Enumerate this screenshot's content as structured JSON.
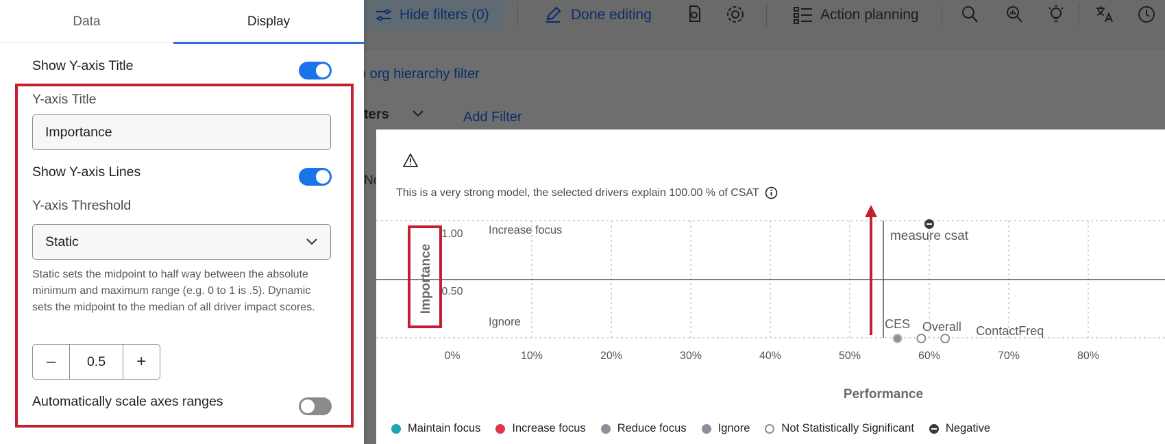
{
  "panel": {
    "tabs": {
      "data": "Data",
      "display": "Display"
    },
    "show_y_title": {
      "label": "Show Y-axis Title",
      "on": true
    },
    "y_title": {
      "label": "Y-axis Title",
      "value": "Importance"
    },
    "show_y_lines": {
      "label": "Show Y-axis Lines",
      "on": true
    },
    "threshold": {
      "label": "Y-axis Threshold",
      "selected": "Static",
      "help": "Static sets the midpoint to half way between the absolute minimum and maximum range (e.g. 0 to 1 is .5). Dynamic sets the midpoint to the median of all driver impact scores."
    },
    "stepper": {
      "minus": "–",
      "value": "0.5",
      "plus": "+"
    },
    "auto_scale": {
      "label": "Automatically scale axes ranges",
      "on": false
    }
  },
  "toolbar": {
    "hide_filters": "Hide filters (0)",
    "done_editing": "Done editing",
    "action_planning": "Action planning"
  },
  "background": {
    "org_filter": "n org hierarchy filter",
    "filters_partial": "ters",
    "add_filter": "Add Filter",
    "no_partial": "No"
  },
  "card": {
    "model_text": "This is a very strong model, the selected drivers explain 100.00 % of CSAT"
  },
  "chart_data": {
    "type": "scatter",
    "title": "",
    "xlabel": "Performance",
    "ylabel": "Importance",
    "x_ticks": [
      "0%",
      "10%",
      "20%",
      "30%",
      "40%",
      "50%",
      "60%",
      "70%",
      "80%"
    ],
    "y_ticks": [
      "1.00",
      "0.50"
    ],
    "quadrant_labels": {
      "top_left": "Increase focus",
      "bottom_left": "Ignore"
    },
    "points": [
      {
        "label": "measure csat",
        "x": 60,
        "y": 1.0,
        "status": "Negative"
      },
      {
        "label": "CES",
        "x": 56,
        "y": 0.0,
        "status": "Reduce focus"
      },
      {
        "label": "Overall",
        "x": 59,
        "y": 0.0,
        "status": "Not Statistically Significant"
      },
      {
        "label": "ContactFreq",
        "x": 62,
        "y": 0.0,
        "status": "Not Statistically Significant"
      }
    ],
    "midline_x": 50,
    "midline_y": 0.5,
    "legend": [
      {
        "label": "Maintain focus",
        "color": "#1fa3b5"
      },
      {
        "label": "Increase focus",
        "color": "#e0344b"
      },
      {
        "label": "Reduce focus",
        "color": "#8a9099"
      },
      {
        "label": "Ignore",
        "color": "#8a9099"
      },
      {
        "label": "Not Statistically Significant",
        "color": "#ffffff"
      },
      {
        "label": "Negative",
        "color": "#3a3a3a"
      }
    ]
  }
}
